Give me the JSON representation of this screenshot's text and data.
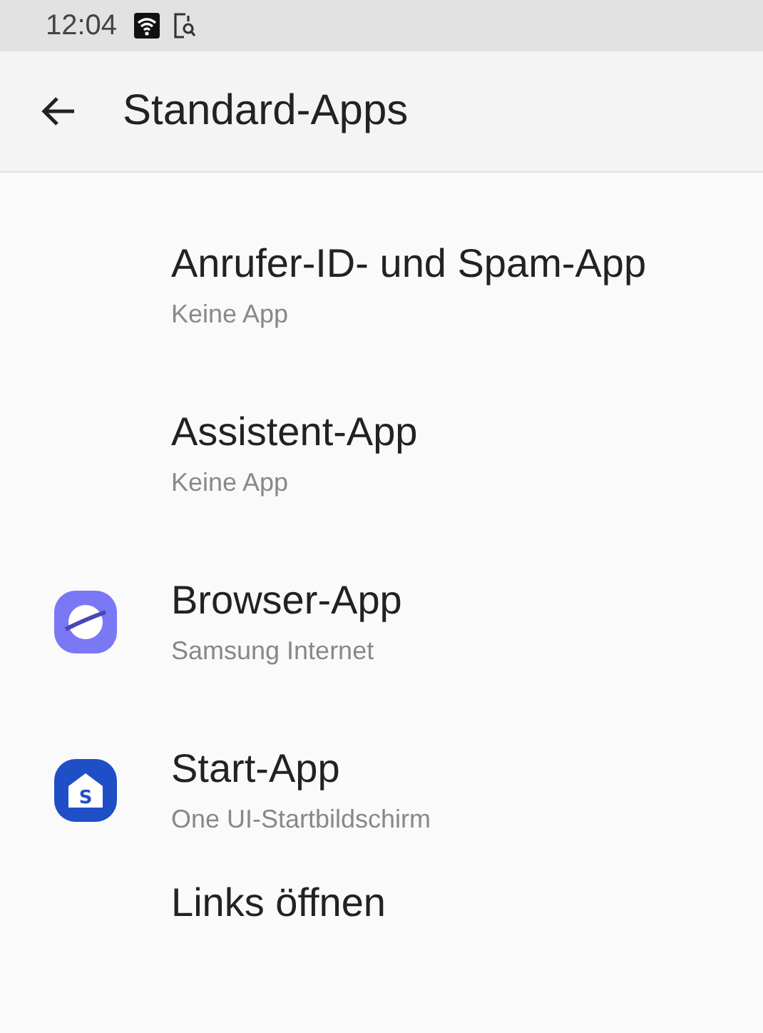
{
  "status_bar": {
    "time": "12:04"
  },
  "header": {
    "title": "Standard-Apps"
  },
  "items": [
    {
      "title": "Anrufer-ID- und Spam-App",
      "subtitle": "Keine App"
    },
    {
      "title": "Assistent-App",
      "subtitle": "Keine App"
    },
    {
      "title": "Browser-App",
      "subtitle": "Samsung Internet",
      "icon": {
        "kind": "planet"
      }
    },
    {
      "title": "Start-App",
      "subtitle": "One UI-Startbildschirm",
      "icon": {
        "kind": "home",
        "letter": "S"
      }
    },
    {
      "title": "Links öffnen"
    }
  ]
}
